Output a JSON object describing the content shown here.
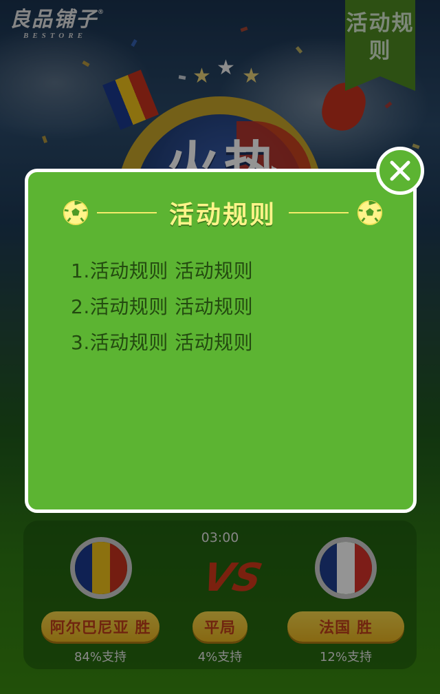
{
  "brand": {
    "name": "良品铺子",
    "registered_mark": "®",
    "subtitle": "BESTORE"
  },
  "header": {
    "rules_button_label": "活动规则"
  },
  "poster": {
    "title_text": "火热"
  },
  "match": {
    "time": "03:00",
    "vs_icon": "vs-icon",
    "home": {
      "result_label": "阿尔巴尼亚 胜",
      "support": "84%支持",
      "flag_colors": [
        "#1b3a8f",
        "#f2c31a",
        "#c8321e"
      ]
    },
    "draw": {
      "result_label": "平局",
      "support": "4%支持"
    },
    "away": {
      "result_label": "法国 胜",
      "support": "12%支持",
      "flag_colors": [
        "#1f3f8f",
        "#ffffff",
        "#d8322a"
      ]
    }
  },
  "modal": {
    "title": "活动规则",
    "title_icon": "soccer-ball-icon",
    "close_icon": "close-icon",
    "rules": [
      "1.活动规则 活动规则",
      "2.活动规则 活动规则",
      "3.活动规则 活动规则"
    ]
  },
  "colors": {
    "modal_bg": "#5cb432",
    "title_yellow": "#fff48a",
    "rule_text": "#234a10",
    "ribbon_green": "#4f8a21"
  }
}
